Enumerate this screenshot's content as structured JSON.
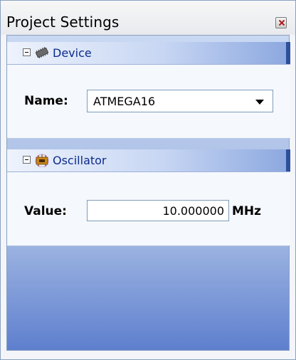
{
  "panel": {
    "title": "Project Settings"
  },
  "sections": {
    "device": {
      "title": "Device",
      "icon": "chip-icon",
      "field_label": "Name:",
      "selected_device": "ATMEGA16"
    },
    "oscillator": {
      "title": "Oscillator",
      "icon": "oscillator-icon",
      "field_label": "Value:",
      "value": "10.000000",
      "unit": "MHz"
    }
  },
  "colors": {
    "section_title": "#0c2a8c",
    "panel_bg": "#c9d8f2",
    "header_edge": "#2e4f9b",
    "close_x": "#b01818"
  }
}
